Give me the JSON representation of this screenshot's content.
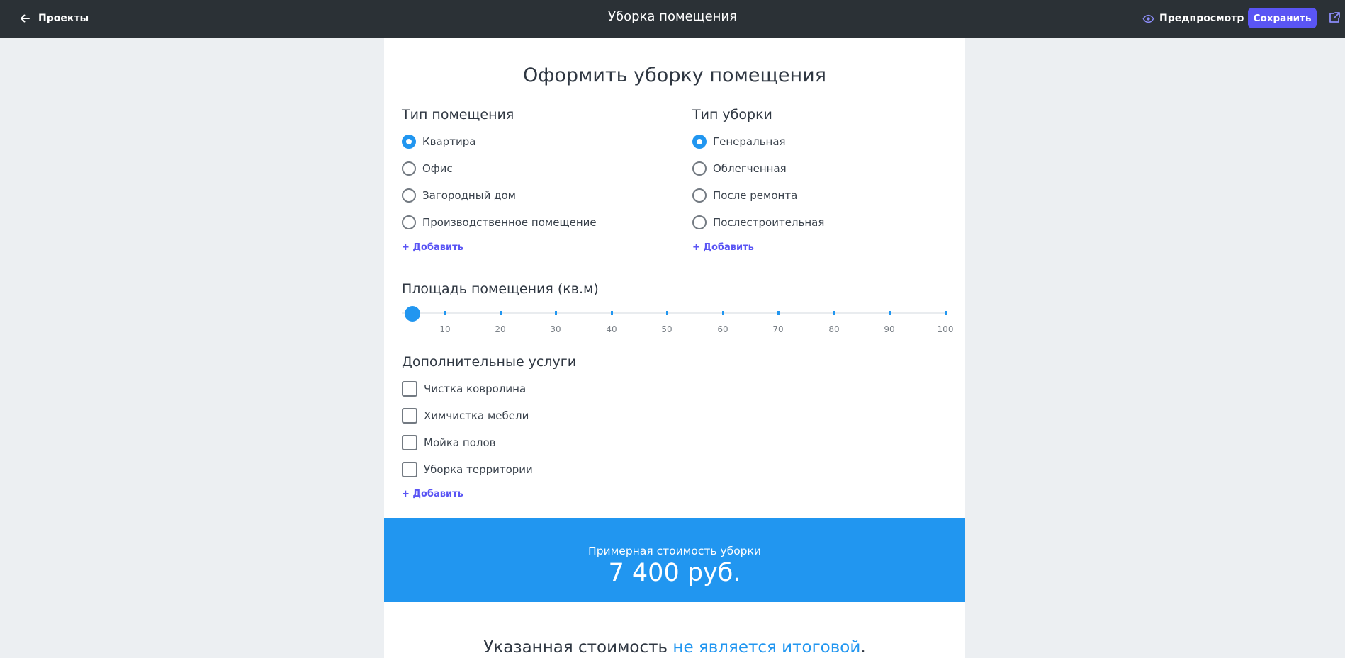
{
  "topbar": {
    "back_label": "Проекты",
    "title": "Уборка помещения",
    "preview_label": "Предпросмотр",
    "save_label": "Сохранить"
  },
  "form": {
    "heading": "Оформить уборку помещения",
    "room_type": {
      "title": "Тип помещения",
      "options": [
        "Квартира",
        "Офис",
        "Загородный дом",
        "Производственное помещение"
      ],
      "selected": "Квартира",
      "add_label": "+ Добавить"
    },
    "cleaning_type": {
      "title": "Тип уборки",
      "options": [
        "Генеральная",
        "Облегченная",
        "После ремонта",
        "Послестроительная"
      ],
      "selected": "Генеральная",
      "add_label": "+ Добавить"
    },
    "area": {
      "title": "Площадь помещения (кв.м)",
      "tick_labels": [
        "10",
        "20",
        "30",
        "40",
        "50",
        "60",
        "70",
        "80",
        "90",
        "100"
      ],
      "value": 0
    },
    "extras": {
      "title": "Дополнительные услуги",
      "options": [
        "Чистка ковролина",
        "Химчистка мебели",
        "Мойка полов",
        "Уборка территории"
      ],
      "add_label": "+ Добавить"
    },
    "price": {
      "label": "Примерная стоимость уборки",
      "value": "7 400 руб."
    },
    "note": {
      "text_before": "Указанная стоимость ",
      "highlight": "не является итоговой",
      "text_after": "."
    }
  },
  "colors": {
    "topbar": "#2b3136",
    "accent": "#2196f0",
    "button": "#5a55f4",
    "background": "#eceff2"
  }
}
